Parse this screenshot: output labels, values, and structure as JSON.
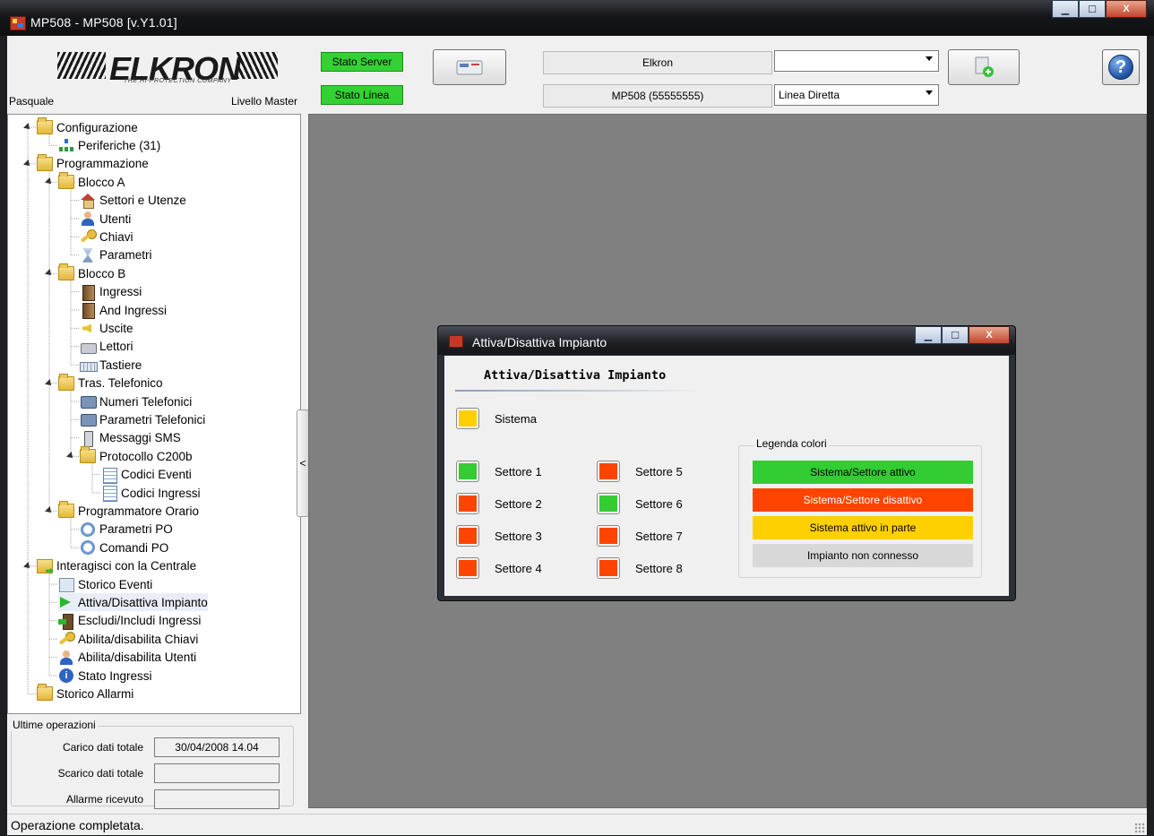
{
  "window": {
    "title": "MP508 - MP508 [v.Y1.01]",
    "minimize": "▁",
    "maximize": "☐",
    "close": "X"
  },
  "header": {
    "brand": "ELKRON",
    "brand_tagline": "THE HI-PROTECTION COMPANY",
    "user": "Pasquale",
    "level": "Livello Master",
    "stato_server": "Stato Server",
    "stato_linea": "Stato Linea",
    "status_color": "#33d133",
    "field_name": "Elkron",
    "field_device": "MP508 (55555555)",
    "combo_top_value": "",
    "combo_line_value": "Linea Diretta",
    "help": "?"
  },
  "tree": [
    {
      "label": "Configurazione",
      "icon": "folder-icon",
      "level": 0,
      "expanded": true
    },
    {
      "label": "Periferiche (31)",
      "icon": "network-icon",
      "level": 1
    },
    {
      "label": "Programmazione",
      "icon": "folder-edit-icon",
      "level": 0,
      "expanded": true
    },
    {
      "label": "Blocco A",
      "icon": "folder-edit-icon",
      "level": 1,
      "expanded": true
    },
    {
      "label": "Settori e Utenze",
      "icon": "house-icon",
      "level": 2
    },
    {
      "label": "Utenti",
      "icon": "user-icon",
      "level": 2
    },
    {
      "label": "Chiavi",
      "icon": "key-icon",
      "level": 2
    },
    {
      "label": "Parametri",
      "icon": "hourglass-icon",
      "level": 2
    },
    {
      "label": "Blocco B",
      "icon": "folder-edit-icon",
      "level": 1,
      "expanded": true
    },
    {
      "label": "Ingressi",
      "icon": "door-icon",
      "level": 2
    },
    {
      "label": "And Ingressi",
      "icon": "door-icon",
      "level": 2
    },
    {
      "label": "Uscite",
      "icon": "speaker-icon",
      "level": 2
    },
    {
      "label": "Lettori",
      "icon": "reader-icon",
      "level": 2
    },
    {
      "label": "Tastiere",
      "icon": "keyboard-icon",
      "level": 2
    },
    {
      "label": "Tras. Telefonico",
      "icon": "folder-phone-icon",
      "level": 1,
      "expanded": true
    },
    {
      "label": "Numeri Telefonici",
      "icon": "phone-icon",
      "level": 2
    },
    {
      "label": "Parametri Telefonici",
      "icon": "phone-icon",
      "level": 2
    },
    {
      "label": "Messaggi SMS",
      "icon": "mobile-icon",
      "level": 2
    },
    {
      "label": "Protocollo C200b",
      "icon": "folder-doc-icon",
      "level": 2,
      "expanded": true
    },
    {
      "label": "Codici Eventi",
      "icon": "document-icon",
      "level": 3
    },
    {
      "label": "Codici Ingressi",
      "icon": "document-icon",
      "level": 3
    },
    {
      "label": "Programmatore Orario",
      "icon": "folder-clock-icon",
      "level": 1,
      "expanded": true
    },
    {
      "label": "Parametri PO",
      "icon": "clock-icon",
      "level": 2
    },
    {
      "label": "Comandi PO",
      "icon": "clock-icon",
      "level": 2
    },
    {
      "label": "Interagisci con la Centrale",
      "icon": "folder-arrow-icon",
      "level": 0,
      "expanded": true
    },
    {
      "label": "Storico Eventi",
      "icon": "history-icon",
      "level": 1
    },
    {
      "label": "Attiva/Disattiva Impianto",
      "icon": "green-arrow-icon",
      "level": 1,
      "selected": true
    },
    {
      "label": "Escludi/Includi Ingressi",
      "icon": "door-arrow-icon",
      "level": 1
    },
    {
      "label": "Abilita/disabilita Chiavi",
      "icon": "key-icon",
      "level": 1
    },
    {
      "label": "Abilita/disabilita Utenti",
      "icon": "user-icon",
      "level": 1
    },
    {
      "label": "Stato Ingressi",
      "icon": "info-icon",
      "level": 1
    },
    {
      "label": "Storico Allarmi",
      "icon": "folder-edit-icon",
      "level": 0
    }
  ],
  "ops": {
    "title": "Ultime operazioni",
    "carico_label": "Carico dati totale",
    "carico_value": "30/04/2008 14.04",
    "scarico_label": "Scarico dati totale",
    "scarico_value": "",
    "allarme_label": "Allarme ricevuto",
    "allarme_value": ""
  },
  "splitter": "<",
  "child": {
    "title": "Attiva/Disattiva Impianto",
    "heading": "Attiva/Disattiva Impianto",
    "sistema_label": "Sistema",
    "sistema_color": "#ffd000",
    "settori": [
      {
        "label": "Settore 1",
        "color": "#33cc33"
      },
      {
        "label": "Settore 2",
        "color": "#ff4400"
      },
      {
        "label": "Settore 3",
        "color": "#ff4400"
      },
      {
        "label": "Settore 4",
        "color": "#ff4400"
      },
      {
        "label": "Settore 5",
        "color": "#ff4400"
      },
      {
        "label": "Settore 6",
        "color": "#33cc33"
      },
      {
        "label": "Settore 7",
        "color": "#ff4400"
      },
      {
        "label": "Settore 8",
        "color": "#ff4400"
      }
    ],
    "legend_title": "Legenda colori",
    "legend": [
      {
        "label": "Sistema/Settore attivo",
        "color": "#33cc33",
        "text_color": "#000000"
      },
      {
        "label": "Sistema/Settore disattivo",
        "color": "#ff4400",
        "text_color": "#ffffff"
      },
      {
        "label": "Sistema attivo in parte",
        "color": "#ffd000",
        "text_color": "#000000"
      },
      {
        "label": "Impianto non connesso",
        "color": "#d8d8d8",
        "text_color": "#000000"
      }
    ]
  },
  "status": {
    "text": "Operazione completata."
  }
}
